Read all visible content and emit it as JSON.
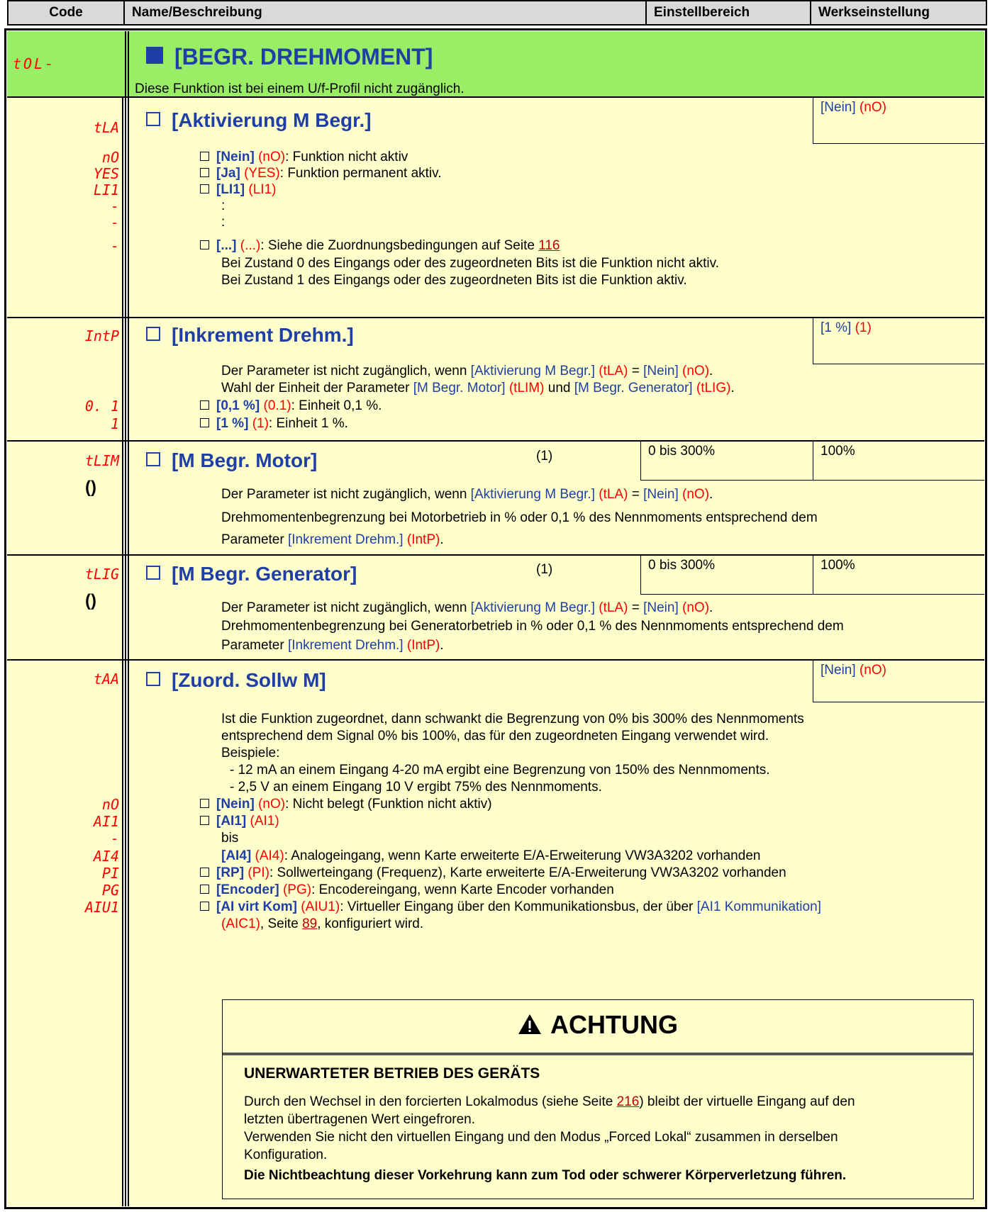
{
  "header": {
    "code": "Code",
    "name": "Name/Beschreibung",
    "range": "Einstellbereich",
    "default": "Werkseinstellung"
  },
  "menu": {
    "code": "tOL-",
    "title": "[BEGR. DREHMOMENT]",
    "note": "Diese Funktion ist bei einem U/f-Profil nicht zugänglich."
  },
  "tla": {
    "code": "tLA",
    "title": "[Aktivierung M Begr.]",
    "default": "[Nein]",
    "default_code": "(nO)",
    "opt_codes": [
      "nO",
      "YES",
      "LI1",
      "-",
      "-",
      "-"
    ],
    "opts": [
      {
        "label": "[Nein]",
        "code": "(nO)",
        "text": ": Funktion nicht aktiv"
      },
      {
        "label": "[Ja]",
        "code": "(YES)",
        "text": ": Funktion permanent aktiv."
      },
      {
        "label": "[LI1]",
        "code": "(LI1)",
        "text": ""
      },
      {
        "label": "[...]",
        "code": "(...)",
        "text": ": Siehe die Zuordnungsbedingungen auf Seite ",
        "page": "116"
      }
    ],
    "dots": [
      ":",
      ":"
    ],
    "line1": "Bei Zustand 0 des Eingangs oder des zugeordneten Bits ist die Funktion nicht aktiv.",
    "line2": "Bei Zustand 1 des Eingangs oder des zugeordneten Bits ist die Funktion aktiv."
  },
  "intp": {
    "code": "IntP",
    "title": "[Inkrement Drehm.]",
    "default": "[1 %]",
    "default_code": "(1)",
    "l1a": "Der Parameter ist nicht zugänglich, wenn ",
    "l1b": "[Aktivierung M Begr.]",
    "l1c": "(tLA)",
    "l1d": " = ",
    "l1e": "[Nein]",
    "l1f": "(nO)",
    "l1g": ".",
    "l2a": "Wahl der Einheit der Parameter ",
    "l2b": "[M Begr. Motor]",
    "l2c": "(tLIM)",
    "l2d": " und ",
    "l2e": "[M Begr. Generator]",
    "l2f": "(tLIG)",
    "l2g": ".",
    "opt_codes": [
      "0. 1",
      "1"
    ],
    "opts": [
      {
        "label": "[0,1 %]",
        "code": "(0.1)",
        "text": ": Einheit 0,1 %."
      },
      {
        "label": "[1 %]",
        "code": "(1)",
        "text": ": Einheit 1 %."
      }
    ]
  },
  "tlim": {
    "code": "tLIM",
    "title": "[M Begr. Motor]",
    "note": "(1)",
    "range": "0 bis 300%",
    "default": "100%",
    "l1a": "Der Parameter ist nicht zugänglich, wenn ",
    "l1b": "[Aktivierung M Begr.]",
    "l1c": "(tLA)",
    "l1d": " = ",
    "l1e": "[Nein]",
    "l1f": "(nO)",
    "l1g": ".",
    "l2": "Drehmomentenbegrenzung bei Motorbetrieb in % oder 0,1 % des Nennmoments entsprechend dem",
    "l3a": "Parameter ",
    "l3b": "[Inkrement Drehm.]",
    "l3c": "(IntP)",
    "l3d": "."
  },
  "tlig": {
    "code": "tLIG",
    "title": "[M Begr. Generator]",
    "note": "(1)",
    "range": "0 bis 300%",
    "default": "100%",
    "l1a": "Der Parameter ist nicht zugänglich, wenn ",
    "l1b": "[Aktivierung M Begr.]",
    "l1c": "(tLA)",
    "l1d": " = ",
    "l1e": "[Nein]",
    "l1f": "(nO)",
    "l1g": ".",
    "l2": "Drehmomentenbegrenzung bei Generatorbetrieb in % oder 0,1 % des Nennmoments entsprechend dem",
    "l3a": "Parameter ",
    "l3b": "[Inkrement Drehm.]",
    "l3c": "(IntP)",
    "l3d": "."
  },
  "taa": {
    "code": "tAA",
    "title": "[Zuord. Sollw M]",
    "default": "[Nein]",
    "default_code": "(nO)",
    "p1": "Ist die Funktion zugeordnet, dann schwankt die Begrenzung von 0% bis 300% des Nennmoments",
    "p2": "entsprechend dem Signal 0% bis 100%, das für den zugeordneten Eingang verwendet wird.",
    "p3": "Beispiele:",
    "p4": "- 12 mA an einem Eingang 4-20 mA ergibt eine Begrenzung von 150% des Nennmoments.",
    "p5": "- 2,5 V an einem Eingang 10 V ergibt 75% des Nennmoments.",
    "opt_codes": [
      "nO",
      "AI1",
      "-",
      "AI4",
      "PI",
      "PG",
      "AIU1"
    ],
    "nein_label": "[Nein]",
    "nein_code": "(nO)",
    "nein_text": ": Nicht belegt (Funktion nicht aktiv)",
    "ai1_label": "[AI1]",
    "ai1_code": "(AI1)",
    "bis": "bis",
    "ai4_label": "[AI4]",
    "ai4_code": "(AI4)",
    "ai4_text": ": Analogeingang, wenn Karte erweiterte E/A-Erweiterung VW3A3202 vorhanden",
    "rp_label": "[RP]",
    "rp_code": "(PI)",
    "rp_text": ": Sollwerteingang (Frequenz), Karte erweiterte E/A-Erweiterung VW3A3202 vorhanden",
    "enc_label": "[Encoder]",
    "enc_code": "(PG)",
    "enc_text": ": Encodereingang, wenn Karte Encoder vorhanden",
    "aiv_label": "[AI virt Kom]",
    "aiv_code": "(AIU1)",
    "aiv_text": ": Virtueller Eingang über den Kommunikationsbus, der über ",
    "aiv_link": "[AI1 Kommunikation]",
    "aiv2_code": "(AIC1)",
    "aiv2_text": ", Seite ",
    "aiv2_page": "89",
    "aiv2_end": ", konfiguriert wird."
  },
  "warning": {
    "title": "ACHTUNG",
    "heading": "UNERWARTETER BETRIEB DES GERÄTS",
    "l1a": "Durch den Wechsel in den forcierten Lokalmodus (siehe Seite ",
    "l1b": "216",
    "l1c": ") bleibt der virtuelle Eingang auf den",
    "l2": "letzten übertragenen Wert eingefroren.",
    "l3": "Verwenden Sie nicht den virtuellen Eingang und den Modus „Forced Lokal“ zusammen in derselben",
    "l4": "Konfiguration.",
    "l5": "Die Nichtbeachtung dieser Vorkehrung kann zum Tod oder schwerer Körperverletzung führen."
  }
}
